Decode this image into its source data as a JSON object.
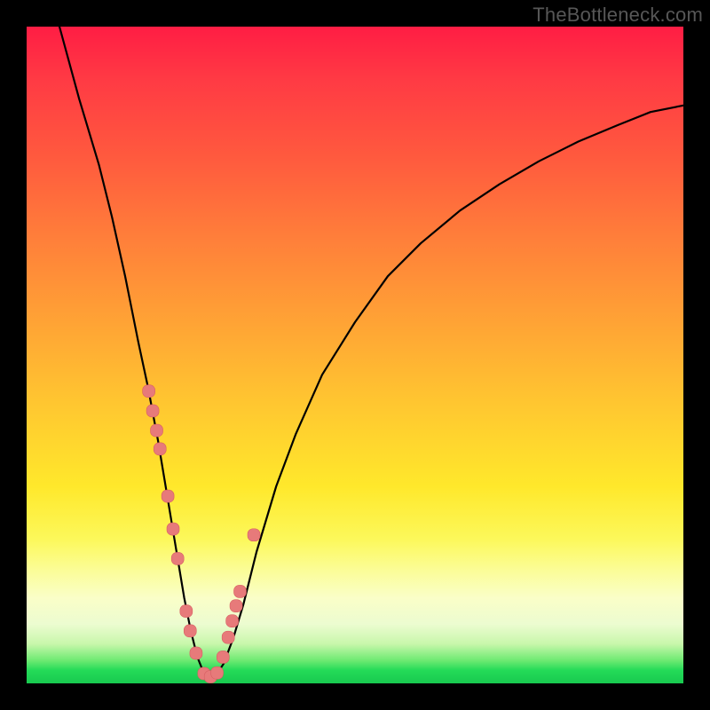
{
  "attribution": "TheBottleneck.com",
  "colors": {
    "frame": "#000000",
    "curve_stroke": "#000000",
    "marker_fill": "#e77a7a",
    "marker_stroke": "#d85f63"
  },
  "chart_data": {
    "type": "line",
    "title": "",
    "xlabel": "",
    "ylabel": "",
    "xlim": [
      0,
      100
    ],
    "ylim": [
      0,
      100
    ],
    "grid": false,
    "legend": false,
    "series": [
      {
        "name": "bottleneck-curve",
        "x": [
          5,
          8,
          11,
          13,
          15,
          17,
          18.5,
          20,
          21,
          22,
          23,
          24,
          25,
          26,
          27,
          28,
          29,
          30,
          31.5,
          33,
          35,
          38,
          41,
          45,
          50,
          55,
          60,
          66,
          72,
          78,
          84,
          90,
          95,
          100
        ],
        "y": [
          100,
          89,
          79,
          71,
          62,
          52,
          45,
          37,
          31,
          25,
          19,
          13,
          8,
          4,
          1.5,
          1,
          1.5,
          3,
          7,
          12,
          20,
          30,
          38,
          47,
          55,
          62,
          67,
          72,
          76,
          79.5,
          82.5,
          85,
          87,
          88
        ]
      }
    ],
    "markers": {
      "name": "highlighted-points",
      "x": [
        18.6,
        19.2,
        19.8,
        20.3,
        21.5,
        22.3,
        23.0,
        24.3,
        24.9,
        25.8,
        27.0,
        28.0,
        29.0,
        29.9,
        30.7,
        31.3,
        31.9,
        32.5,
        34.6
      ],
      "y": [
        44.5,
        41.5,
        38.5,
        35.7,
        28.5,
        23.5,
        19.0,
        11.0,
        8.0,
        4.6,
        1.5,
        1.0,
        1.6,
        4.0,
        7.0,
        9.5,
        11.8,
        14.0,
        22.6
      ]
    },
    "background_gradient": {
      "direction": "vertical",
      "stops": [
        {
          "pos": 0.0,
          "color": "#ff1d44"
        },
        {
          "pos": 0.45,
          "color": "#ffa335"
        },
        {
          "pos": 0.7,
          "color": "#ffe82b"
        },
        {
          "pos": 0.88,
          "color": "#fafec8"
        },
        {
          "pos": 0.97,
          "color": "#24db58"
        },
        {
          "pos": 1.0,
          "color": "#18c94f"
        }
      ]
    }
  }
}
